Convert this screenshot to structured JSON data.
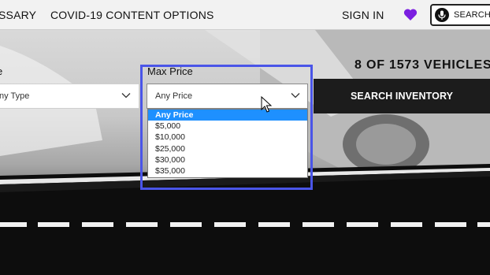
{
  "nav": {
    "items": [
      "SSARY",
      "COVID-19 CONTENT OPTIONS",
      "SIGN IN"
    ],
    "favorites_icon": "heart-icon",
    "search_label": "SEARCH A",
    "search_icon": "microphone-icon"
  },
  "filters": {
    "type": {
      "label": "e",
      "value": "ny Type"
    },
    "max_price": {
      "label": "Max Price",
      "value": "Any Price",
      "options": [
        "Any Price",
        "$5,000",
        "$10,000",
        "$25,000",
        "$30,000",
        "$35,000"
      ],
      "selected_index": 0
    }
  },
  "results": {
    "count_text": "8 OF 1573 VEHICLES"
  },
  "search_button": {
    "label": "SEARCH INVENTORY"
  },
  "colors": {
    "accent_heart": "#7b1fe0",
    "highlight_box": "#4a55e8",
    "selected_option": "#1e90ff",
    "button_bg": "#1c1c1c"
  }
}
